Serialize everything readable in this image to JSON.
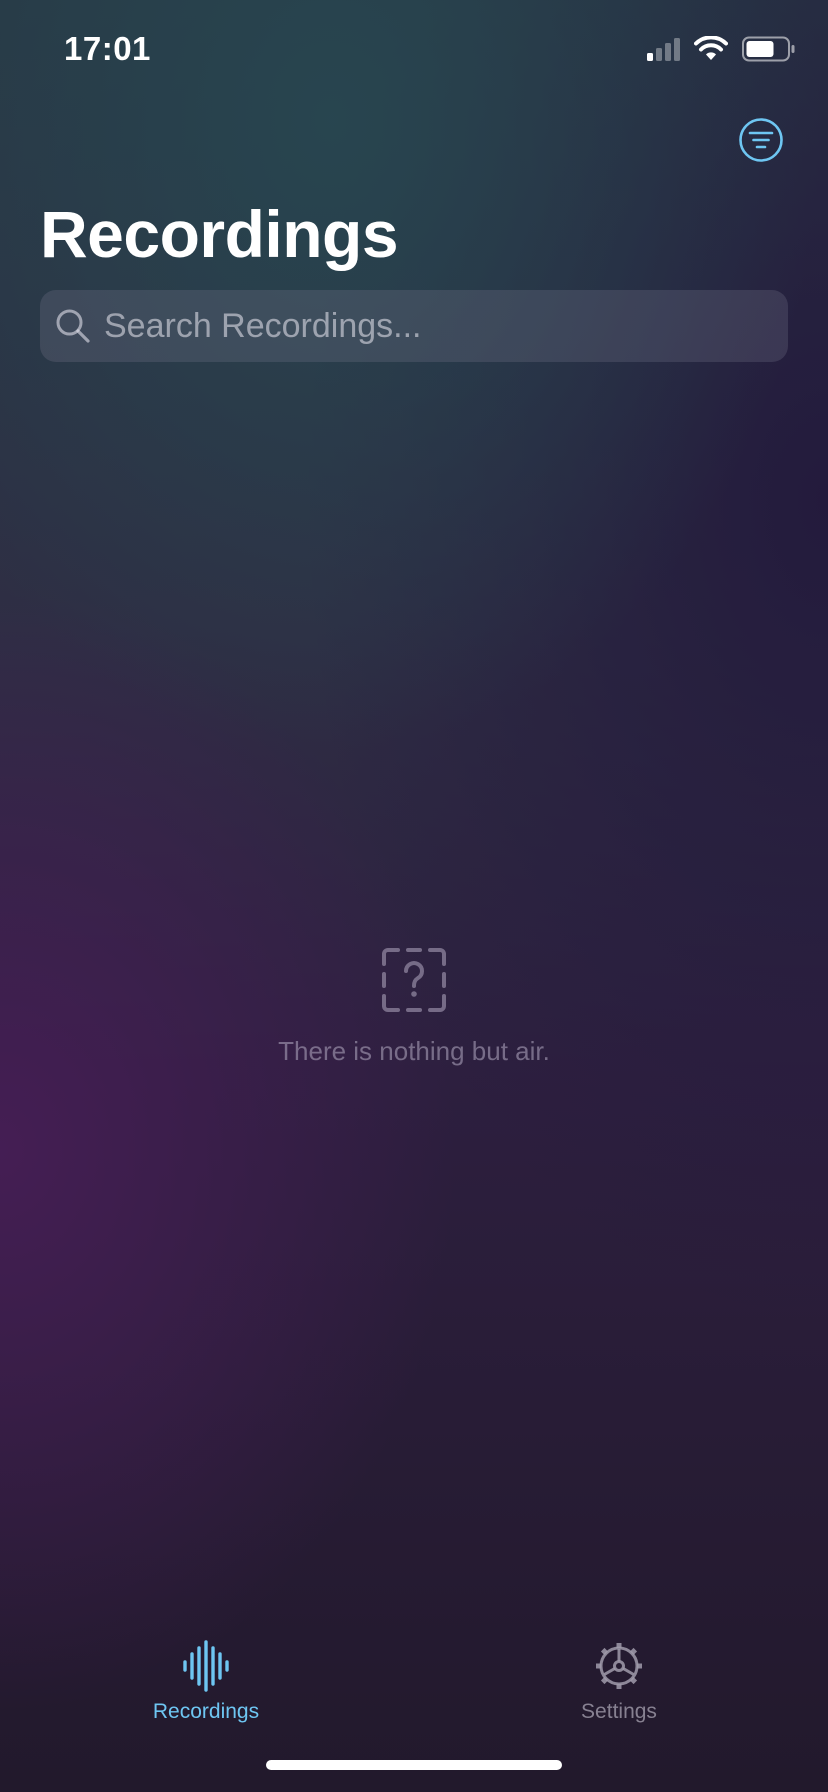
{
  "status_bar": {
    "time": "17:01",
    "signal_bars_active": 1,
    "signal_bars_total": 4,
    "battery_level": 0.6,
    "icons": [
      "signal-icon",
      "wifi-icon",
      "battery-icon"
    ]
  },
  "header": {
    "title": "Recordings",
    "filter_icon": "filter-icon"
  },
  "search": {
    "placeholder": "Search Recordings...",
    "value": "",
    "icon": "search-icon"
  },
  "empty_state": {
    "icon": "question-mark-icon",
    "message": "There is nothing but air."
  },
  "tab_bar": {
    "tabs": [
      {
        "label": "Recordings",
        "icon": "waveform-icon",
        "selected": true
      },
      {
        "label": "Settings",
        "icon": "gear-icon",
        "selected": false
      }
    ]
  },
  "colors": {
    "accent": "#6ec6f2",
    "inactive": "#9f9baa",
    "empty_text": "#8a8098"
  }
}
